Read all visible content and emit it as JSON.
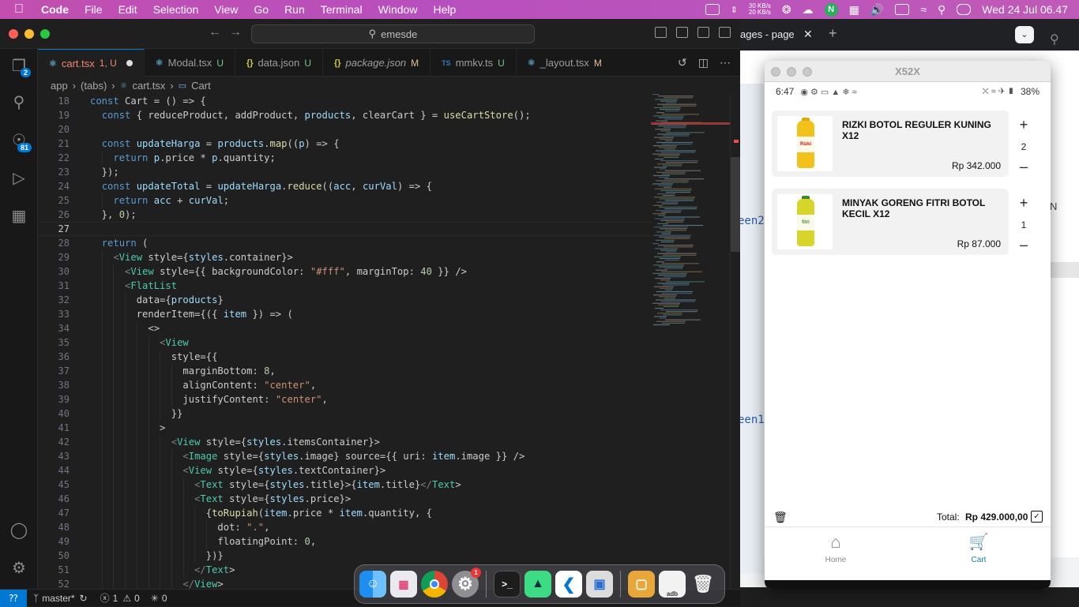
{
  "menubar": {
    "app": "Code",
    "items": [
      "File",
      "Edit",
      "Selection",
      "View",
      "Go",
      "Run",
      "Terminal",
      "Window",
      "Help"
    ],
    "net_up": "30 KB/s",
    "net_down": "20 KB/s",
    "datetime": "Wed 24 Jul  06.47"
  },
  "vscode": {
    "search": "emesde",
    "tabs": [
      {
        "label": "cart.tsx",
        "status": "1, U",
        "icon": "⚛",
        "active": true
      },
      {
        "label": "Modal.tsx",
        "status": "U",
        "icon": "⚛"
      },
      {
        "label": "data.json",
        "status": "U",
        "icon": "{}"
      },
      {
        "label": "package.json",
        "status": "M",
        "icon": "{}"
      },
      {
        "label": "mmkv.ts",
        "status": "U",
        "icon": "TS"
      },
      {
        "label": "_layout.tsx",
        "status": "M",
        "icon": "⚛"
      }
    ],
    "breadcrumb": [
      "app",
      "(tabs)",
      "cart.tsx",
      "Cart"
    ],
    "explorer_badge": "2",
    "scm_badge": "81",
    "status": {
      "branch": "master*",
      "errors": "1",
      "warnings": "0",
      "ports": "0"
    },
    "line_numbers": [
      "18",
      "19",
      "20",
      "21",
      "22",
      "23",
      "24",
      "25",
      "26",
      "27",
      "28",
      "29",
      "30",
      "31",
      "32",
      "33",
      "34",
      "35",
      "36",
      "37",
      "38",
      "39",
      "40",
      "41",
      "42",
      "43",
      "44",
      "45",
      "46",
      "47",
      "48",
      "49",
      "50",
      "51",
      "52"
    ],
    "code_lines": [
      "const Cart = () => {",
      "  const { reduceProduct, addProduct, products, clearCart } = useCartStore();",
      "",
      "  const updateHarga = products.map((p) => {",
      "    return p.price * p.quantity;",
      "  });",
      "  const updateTotal = updateHarga.reduce((acc, curVal) => {",
      "    return acc + curVal;",
      "  }, 0);",
      "",
      "  return (",
      "    <View style={styles.container}>",
      "      <View style={{ backgroundColor: \"#fff\", marginTop: 40 }} />",
      "      <FlatList",
      "        data={products}",
      "        renderItem={({ item }) => (",
      "          <>",
      "            <View",
      "              style={{",
      "                marginBottom: 8,",
      "                alignContent: \"center\",",
      "                justifyContent: \"center\",",
      "              }}",
      "            >",
      "              <View style={styles.itemsContainer}>",
      "                <Image style={styles.image} source={{ uri: item.image }} />",
      "                <View style={styles.textContainer}>",
      "                  <Text style={styles.title}>{item.title}</Text>",
      "                  <Text style={styles.price}>",
      "                    {toRupiah(item.price * item.quantity, {",
      "                      dot: \".\",",
      "                      floatingPoint: 0,",
      "                    })}",
      "                  </Text>",
      "                </View>"
    ]
  },
  "browser": {
    "tab_label": "ages - page",
    "side_texts": [
      "een2",
      "een1",
      "N"
    ]
  },
  "emulator": {
    "title": "X52X",
    "time": "6:47",
    "battery": "38%",
    "items": [
      {
        "title": "RIZKI BOTOL REGULER KUNING X12",
        "price": "Rp 342.000",
        "qty": "2",
        "bottle_color": "#f2c21b",
        "label_text": "Rizki"
      },
      {
        "title": "MINYAK GORENG FITRI BOTOL KECIL X12",
        "price": "Rp 87.000",
        "qty": "1",
        "bottle_color": "#d8d52a",
        "label_text": "fitri"
      }
    ],
    "total_label": "Total:",
    "total_value": "Rp 429.000,00",
    "nav": [
      {
        "label": "Home",
        "icon": "home-icon"
      },
      {
        "label": "Cart",
        "icon": "cart-icon",
        "active": true
      }
    ],
    "accent": "#1a7fb5"
  },
  "dock": {
    "settings_badge": "1",
    "adb_label": "adb"
  }
}
